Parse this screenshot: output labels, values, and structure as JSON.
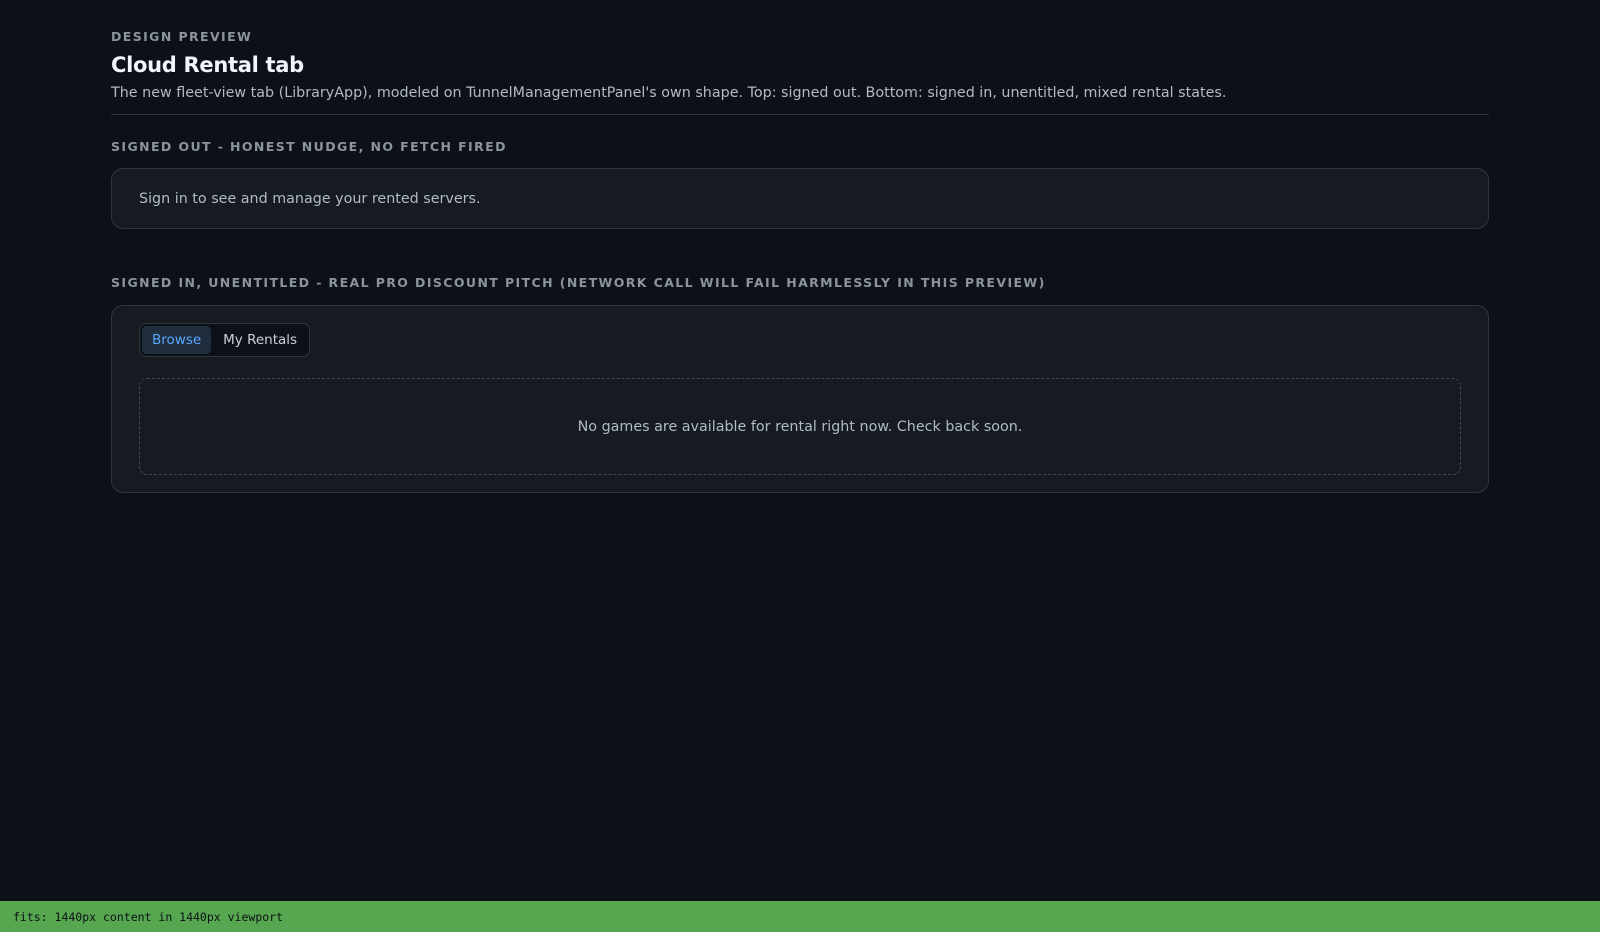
{
  "header": {
    "eyebrow": "DESIGN PREVIEW",
    "title": "Cloud Rental tab",
    "subtitle": "The new fleet-view tab (LibraryApp), modeled on TunnelManagementPanel's own shape. Top: signed out. Bottom: signed in, unentitled, mixed rental states."
  },
  "signed_out": {
    "label": "SIGNED OUT - HONEST NUDGE, NO FETCH FIRED",
    "message": "Sign in to see and manage your rented servers."
  },
  "signed_in": {
    "label": "SIGNED IN, UNENTITLED - REAL PRO DISCOUNT PITCH (NETWORK CALL WILL FAIL HARMLESSLY IN THIS PREVIEW)",
    "tabs": [
      {
        "label": "Browse",
        "active": true
      },
      {
        "label": "My Rentals",
        "active": false
      }
    ],
    "empty_message": "No games are available for rental right now. Check back soon."
  },
  "status_bar": {
    "text": "fits: 1440px content in 1440px viewport"
  },
  "colors": {
    "background": "#0d1117",
    "card": "#161b22",
    "accent": "#58a6ff",
    "status_ok": "#56a74f"
  }
}
